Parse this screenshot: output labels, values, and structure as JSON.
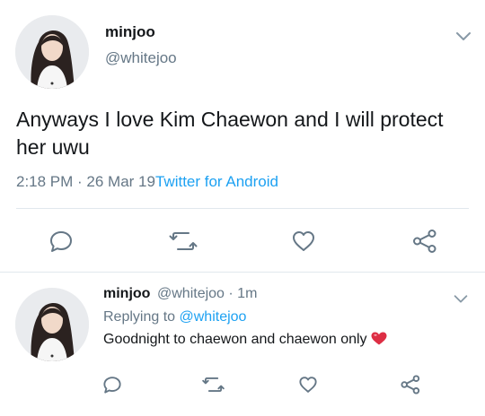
{
  "main_tweet": {
    "display_name": "minjoo",
    "handle": "@whitejoo",
    "text": "Anyways I love Kim Chaewon and I will protect her uwu",
    "time": "2:18 PM · 26 Mar 19",
    "source": "Twitter for Android",
    "avatar_icon": "profile-photo",
    "menu_icon": "chevron-down-icon",
    "actions": [
      "reply-icon",
      "retweet-icon",
      "like-icon",
      "share-icon"
    ]
  },
  "reply_tweet": {
    "display_name": "minjoo",
    "handle": "@whitejoo",
    "relative_time": "1m",
    "replying_prefix": "Replying to",
    "replying_to": "@whitejoo",
    "text": "Goodnight to chaewon and chaewon only",
    "emoji": "red-heart",
    "avatar_icon": "profile-photo",
    "menu_icon": "chevron-down-icon",
    "actions": [
      "reply-icon",
      "retweet-icon",
      "like-icon",
      "share-icon"
    ]
  },
  "colors": {
    "text": "#14171a",
    "secondary": "#657786",
    "link": "#1da1f2",
    "divider": "#e1e8ed",
    "icon": "#657786"
  }
}
